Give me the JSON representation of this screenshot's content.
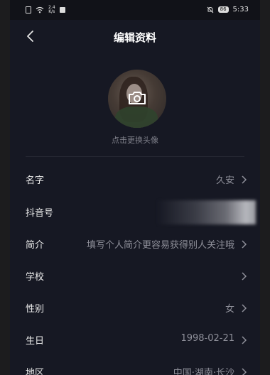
{
  "status_bar": {
    "network_speed_top": "2.4",
    "network_speed_bottom": "K/s",
    "battery": "86",
    "time": "5:33"
  },
  "header": {
    "title": "编辑资料",
    "back_icon": "chevron-left-icon"
  },
  "avatar": {
    "icon": "camera-icon",
    "change_label": "点击更换头像"
  },
  "rows": [
    {
      "label": "名字",
      "value": "久安"
    },
    {
      "label": "抖音号",
      "value": ""
    },
    {
      "label": "简介",
      "value": "填写个人简介更容易获得别人关注哦"
    },
    {
      "label": "学校",
      "value": ""
    },
    {
      "label": "性别",
      "value": "女"
    },
    {
      "label": "生日",
      "value": "1998-02-21"
    },
    {
      "label": "地区",
      "value": "中国·湖南·长沙"
    }
  ],
  "colors": {
    "background": "#161823",
    "text_primary": "#eaeaea",
    "text_secondary": "#8e8f99"
  }
}
